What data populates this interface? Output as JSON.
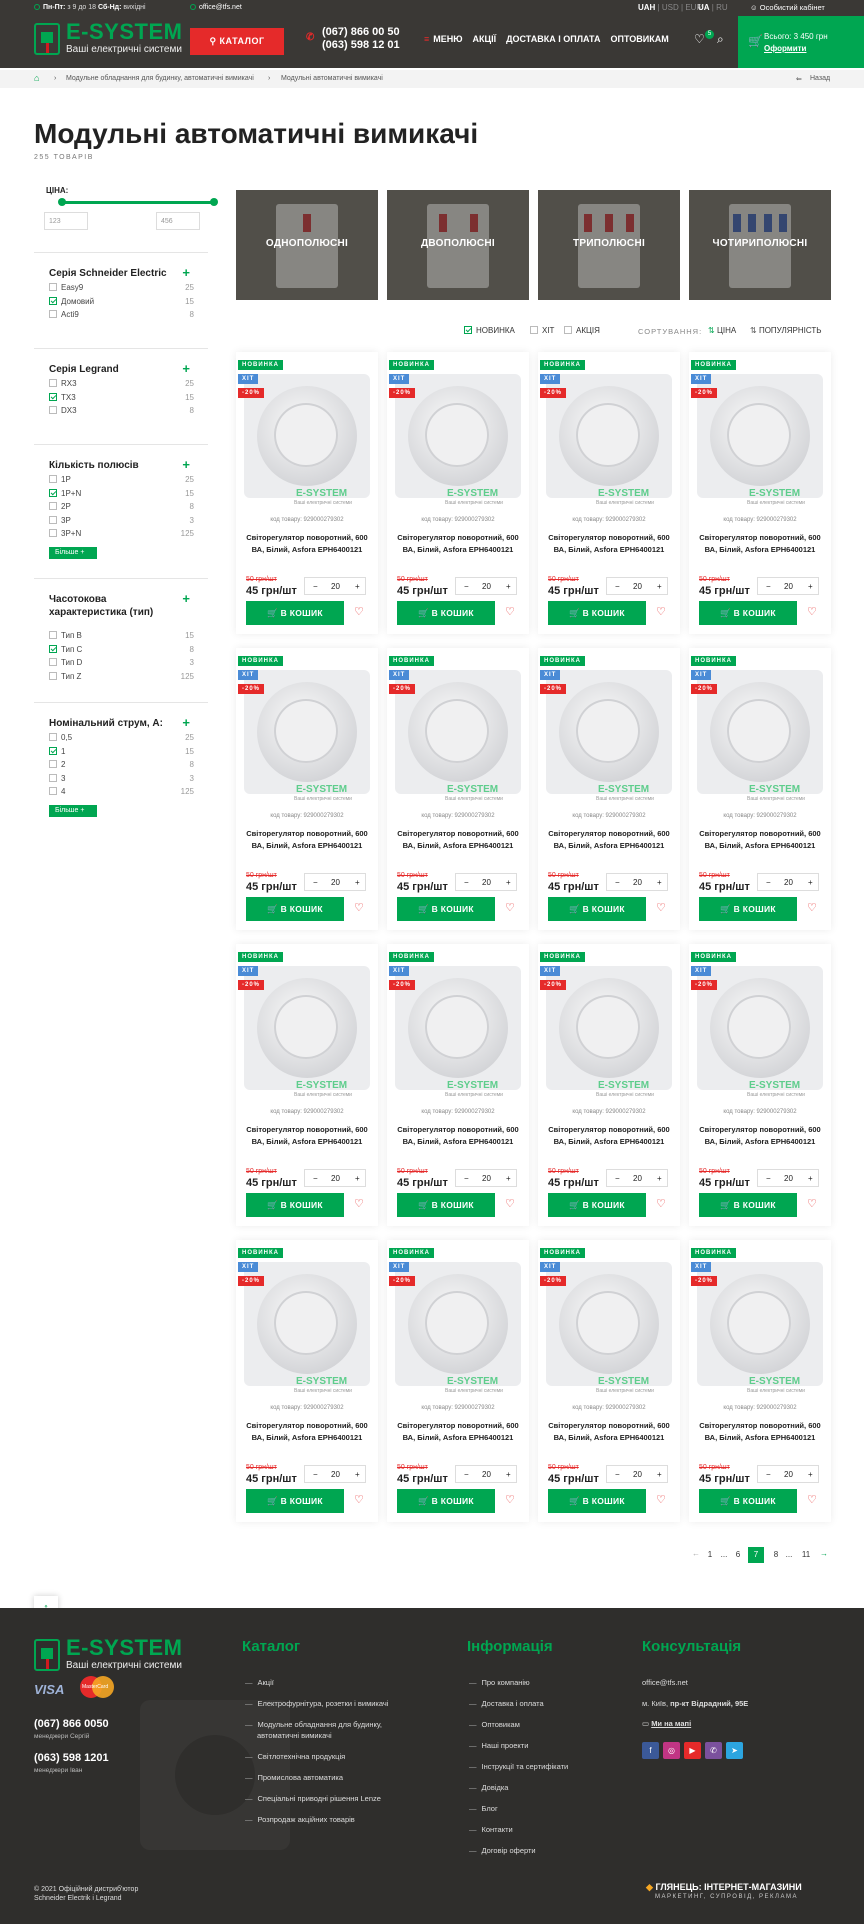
{
  "header": {
    "hours_label": "Пн-Пт:",
    "hours_value": "з 9 до 18",
    "weekend_label": "Сб-Нд:",
    "weekend_value": "вихідні",
    "email": "office@tfs.net",
    "currency": [
      "UAH",
      "USD",
      "EUR"
    ],
    "languages": [
      "UA",
      "RU"
    ],
    "account": "Особистий кабінет",
    "logo_title": "E-SYSTEM",
    "logo_subtitle": "Ваші електричні системи",
    "catalog_button": "КАТАЛОГ",
    "phone1": "(067) 866 00 50",
    "phone2": "(063) 598 12 01",
    "nav": [
      "МЕНЮ",
      "АКЦІЇ",
      "ДОСТАВКА І ОПЛАТА",
      "ОПТОВИКАМ"
    ],
    "wishlist_count": "5",
    "cart_total": "Всього: 3 450 грн",
    "cart_checkout": "Оформити"
  },
  "breadcrumbs": {
    "items": [
      "Модульне обладнання для будинку, автоматичні вимикачі",
      "Модульні автоматичні вимикачі"
    ],
    "back": "Назад"
  },
  "page": {
    "title": "Модульні автоматичні вимикачі",
    "count": "255 ТОВАРІВ"
  },
  "filters": {
    "price_label": "ЦІНА:",
    "price_min": "123",
    "price_max": "456",
    "groups": [
      {
        "title": "Серія Schneider Electric",
        "items": [
          {
            "label": "Easy9",
            "count": "25",
            "checked": false
          },
          {
            "label": "Домовий",
            "count": "15",
            "checked": true
          },
          {
            "label": "Acti9",
            "count": "8",
            "checked": false
          }
        ]
      },
      {
        "title": "Серія Legrand",
        "items": [
          {
            "label": "RX3",
            "count": "25",
            "checked": false
          },
          {
            "label": "TX3",
            "count": "15",
            "checked": true
          },
          {
            "label": "DX3",
            "count": "8",
            "checked": false
          }
        ]
      },
      {
        "title": "Кількість полюсів",
        "items": [
          {
            "label": "1P",
            "count": "25",
            "checked": false
          },
          {
            "label": "1P+N",
            "count": "15",
            "checked": true
          },
          {
            "label": "2P",
            "count": "8",
            "checked": false
          },
          {
            "label": "3P",
            "count": "3",
            "checked": false
          },
          {
            "label": "3P+N",
            "count": "125",
            "checked": false
          }
        ],
        "more": "Більше"
      },
      {
        "title": "Часотокова характеристика (тип)",
        "items": [
          {
            "label": "Тип B",
            "count": "15",
            "checked": false
          },
          {
            "label": "Тип C",
            "count": "8",
            "checked": true
          },
          {
            "label": "Тип D",
            "count": "3",
            "checked": false
          },
          {
            "label": "Тип Z",
            "count": "125",
            "checked": false
          }
        ]
      },
      {
        "title": "Номінальний струм, А:",
        "items": [
          {
            "label": "0,5",
            "count": "25",
            "checked": false
          },
          {
            "label": "1",
            "count": "15",
            "checked": true
          },
          {
            "label": "2",
            "count": "8",
            "checked": false
          },
          {
            "label": "3",
            "count": "3",
            "checked": false
          },
          {
            "label": "4",
            "count": "125",
            "checked": false
          }
        ],
        "more": "Більше"
      }
    ]
  },
  "categories": [
    "ОДНОПОЛЮСНІ",
    "ДВОПОЛЮСНІ",
    "ТРИПОЛЮСНІ",
    "ЧОТИРИПОЛЮСНІ"
  ],
  "toolbar": {
    "filters": [
      {
        "label": "НОВИНКА",
        "checked": true
      },
      {
        "label": "ХІТ",
        "checked": false
      },
      {
        "label": "АКЦІЯ",
        "checked": false
      }
    ],
    "sort_label": "СОРТУВАННЯ:",
    "sort_options": [
      "ЦІНА",
      "ПОПУЛЯРНІСТЬ"
    ]
  },
  "product": {
    "tag_new": "НОВИНКА",
    "tag_hit": "ХІТ",
    "tag_sale": "-20%",
    "watermark": "E-SYSTEM",
    "watermark_sub": "Ваші електричні системи",
    "code": "код товару: 929000279302",
    "name": "Світорегулятор поворотний, 600 ВА, Білий, Asfora EPH6400121",
    "old_price": "50 грн/шт",
    "price": "45 грн/шт",
    "qty": "20",
    "buy": "В КОШИК"
  },
  "pagination": [
    "1",
    "...",
    "6",
    "7",
    "8",
    "...",
    "11"
  ],
  "pagination_active": "7",
  "footer": {
    "logo_title": "E-SYSTEM",
    "logo_subtitle": "Ваші електричні системи",
    "visa": "VISA",
    "mastercard": "MasterCard",
    "phone1": "(067) 866 0050",
    "phone1_sub": "менеджери Сергій",
    "phone2": "(063) 598 1201",
    "phone2_sub": "менеджери Іван",
    "catalog_title": "Каталог",
    "catalog": [
      "Акції",
      "Електрофурнітура, розетки і вимикачі",
      "Модульне обладнання для будинку,",
      "автоматичні вимикачі",
      "Світлотехнічна продукція",
      "Промислова автоматика",
      "Спеціальні приводні рішення Lenze",
      "Розпродаж акційних товарів"
    ],
    "info_title": "Інформація",
    "info": [
      "Про компанію",
      "Доставка і оплата",
      "Оптовикам",
      "Наші проекти",
      "Інструкції та сертифікати",
      "Довідка",
      "Блог",
      "Контакти",
      "Договір оферти"
    ],
    "consult_title": "Консультація",
    "email": "office@tfs.net",
    "address_city": "м. Київ,",
    "address_street": "пр-кт Відрадний, 95Е",
    "map": "Ми на мапі",
    "copyright1": "© 2021 Офіційний дистриб'ютор",
    "copyright2": "Schneider Electrik і Legrand",
    "dev": "ГЛЯНЕЦЬ: ІНТЕРНЕТ-МАГАЗИНИ",
    "dev_sub": "МАРКЕТИНГ, СУПРОВІД, РЕКЛАМА"
  },
  "colors": {
    "accent": "#00a651",
    "alert": "#e52a2a",
    "dark": "#3a3835"
  }
}
